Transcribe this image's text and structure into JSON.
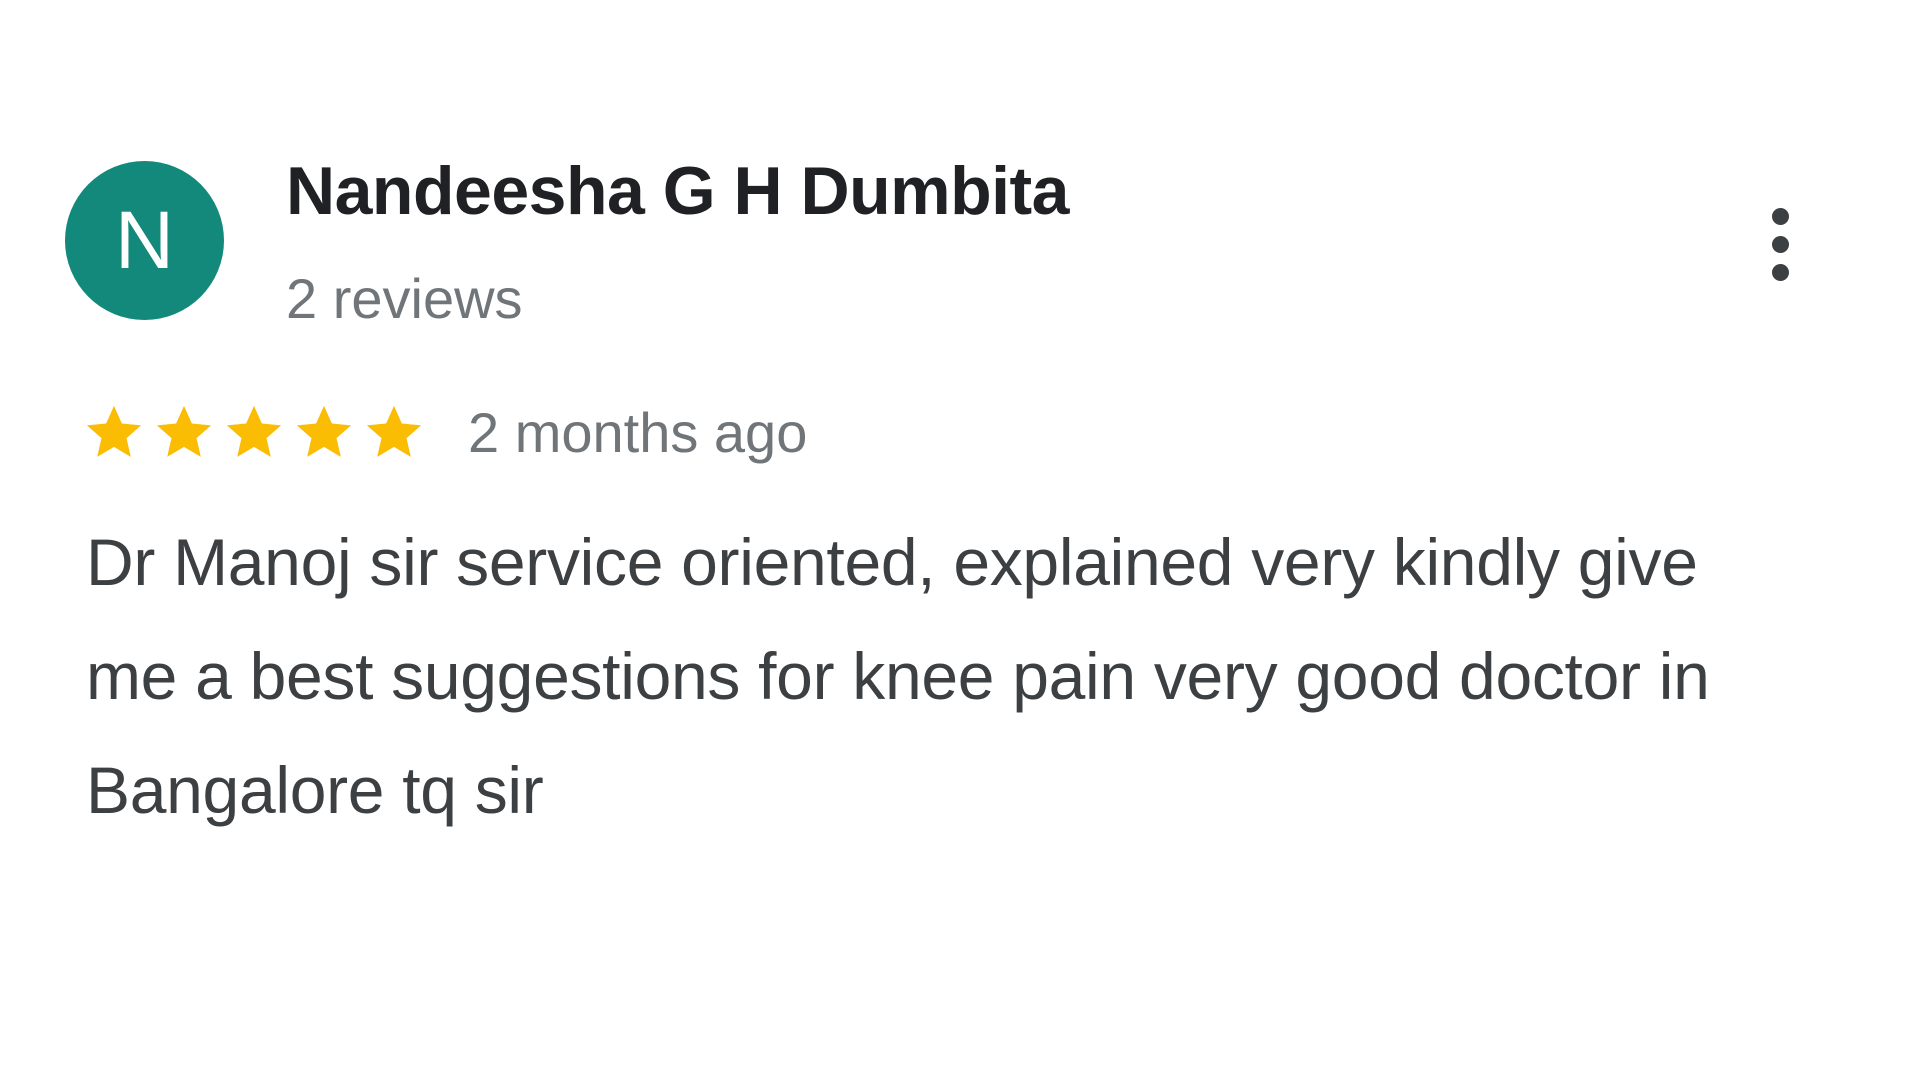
{
  "reviewer": {
    "initial": "N",
    "avatar_color": "#12897a",
    "name": "Nandeesha G H Dumbita",
    "review_count": "2 reviews"
  },
  "menu": {
    "icon": "more-vert-icon"
  },
  "rating": {
    "stars": 5,
    "max_stars": 5,
    "star_color": "#fbbc04",
    "star_icon": "star-icon"
  },
  "review": {
    "time_ago": "2 months ago",
    "text": "Dr Manoj sir service oriented, explained very kindly give me a best suggestions for knee pain very good doctor in Bangalore tq sir"
  }
}
